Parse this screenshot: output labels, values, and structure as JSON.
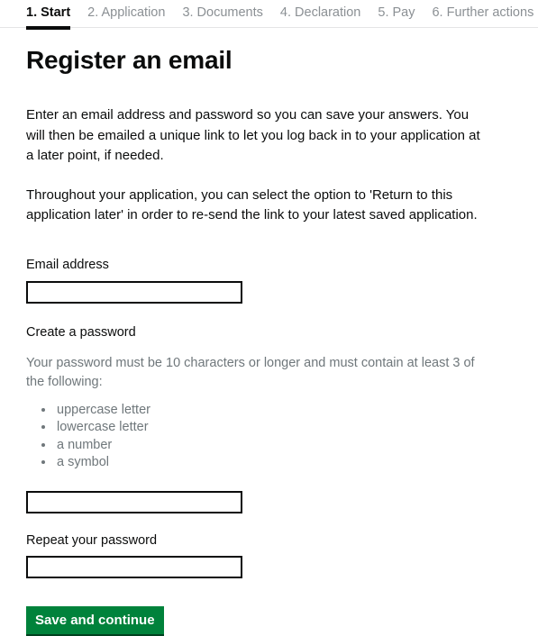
{
  "step_nav": {
    "items": [
      {
        "label": "1. Start",
        "current": true
      },
      {
        "label": "2. Application",
        "current": false
      },
      {
        "label": "3. Documents",
        "current": false
      },
      {
        "label": "4. Declaration",
        "current": false
      },
      {
        "label": "5. Pay",
        "current": false
      },
      {
        "label": "6. Further actions",
        "current": false
      }
    ]
  },
  "main": {
    "title": "Register an email",
    "paragraph_1": "Enter an email address and password so you can save your answers. You will then be emailed a unique link to let you log back in to your application at a later point, if needed.",
    "paragraph_2": "Throughout your application, you can select the option to 'Return to this application later' in order to re-send the link to your latest saved application."
  },
  "form": {
    "email": {
      "label": "Email address",
      "value": "",
      "placeholder": ""
    },
    "password": {
      "label": "Create a password",
      "hint": "Your password must be 10 characters or longer and must contain at least 3 of the following:",
      "requirements": [
        "uppercase letter",
        "lowercase letter",
        "a number",
        "a symbol"
      ],
      "value": "",
      "placeholder": ""
    },
    "repeat_password": {
      "label": "Repeat your password",
      "value": "",
      "placeholder": ""
    },
    "submit_label": "Save and continue"
  },
  "colors": {
    "accent_green": "#00823b",
    "accent_green_shadow": "#00401f",
    "text": "#0b0c0c",
    "muted_text": "#6f777b",
    "rule": "#e4e5e6"
  }
}
